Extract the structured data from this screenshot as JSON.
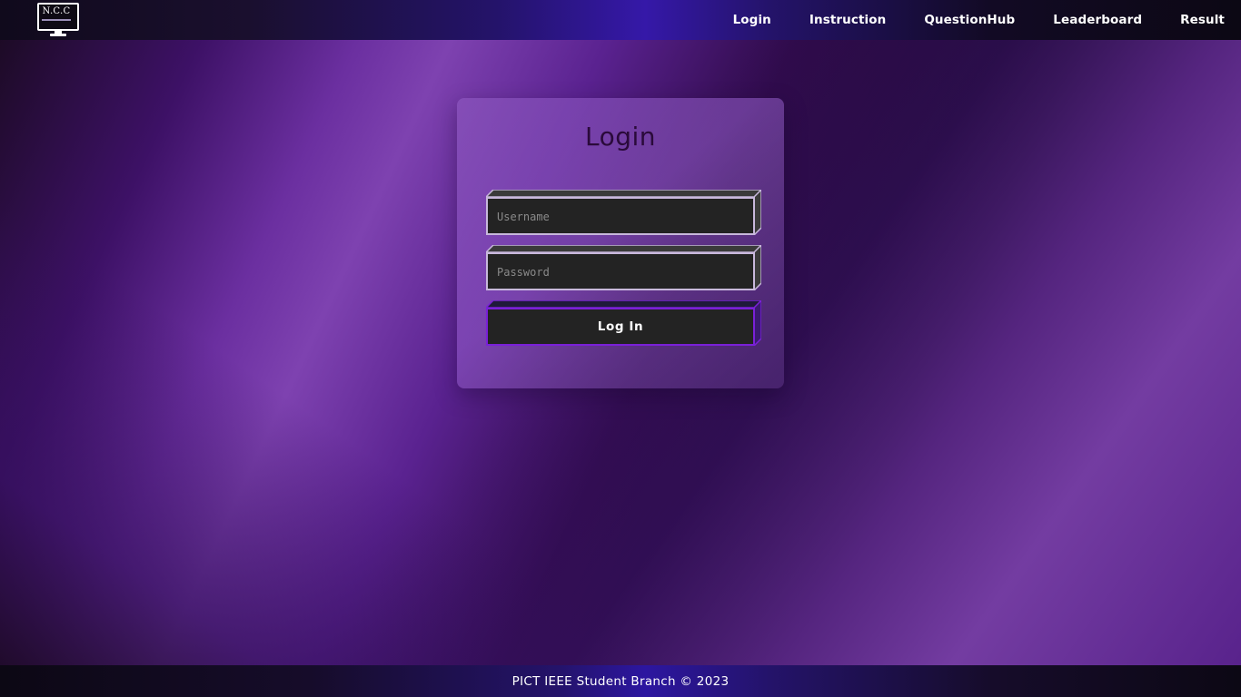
{
  "header": {
    "logo_text": "N.C.C",
    "nav": [
      {
        "label": "Login"
      },
      {
        "label": "Instruction"
      },
      {
        "label": "QuestionHub"
      },
      {
        "label": "Leaderboard"
      },
      {
        "label": "Result"
      }
    ]
  },
  "login": {
    "title": "Login",
    "username_placeholder": "Username",
    "password_placeholder": "Password",
    "submit_label": "Log In"
  },
  "footer": {
    "text": "PICT IEEE Student Branch © 2023"
  },
  "colors": {
    "accent": "#7a20d8",
    "field_bg": "#232323",
    "title": "#2a0a3a"
  }
}
